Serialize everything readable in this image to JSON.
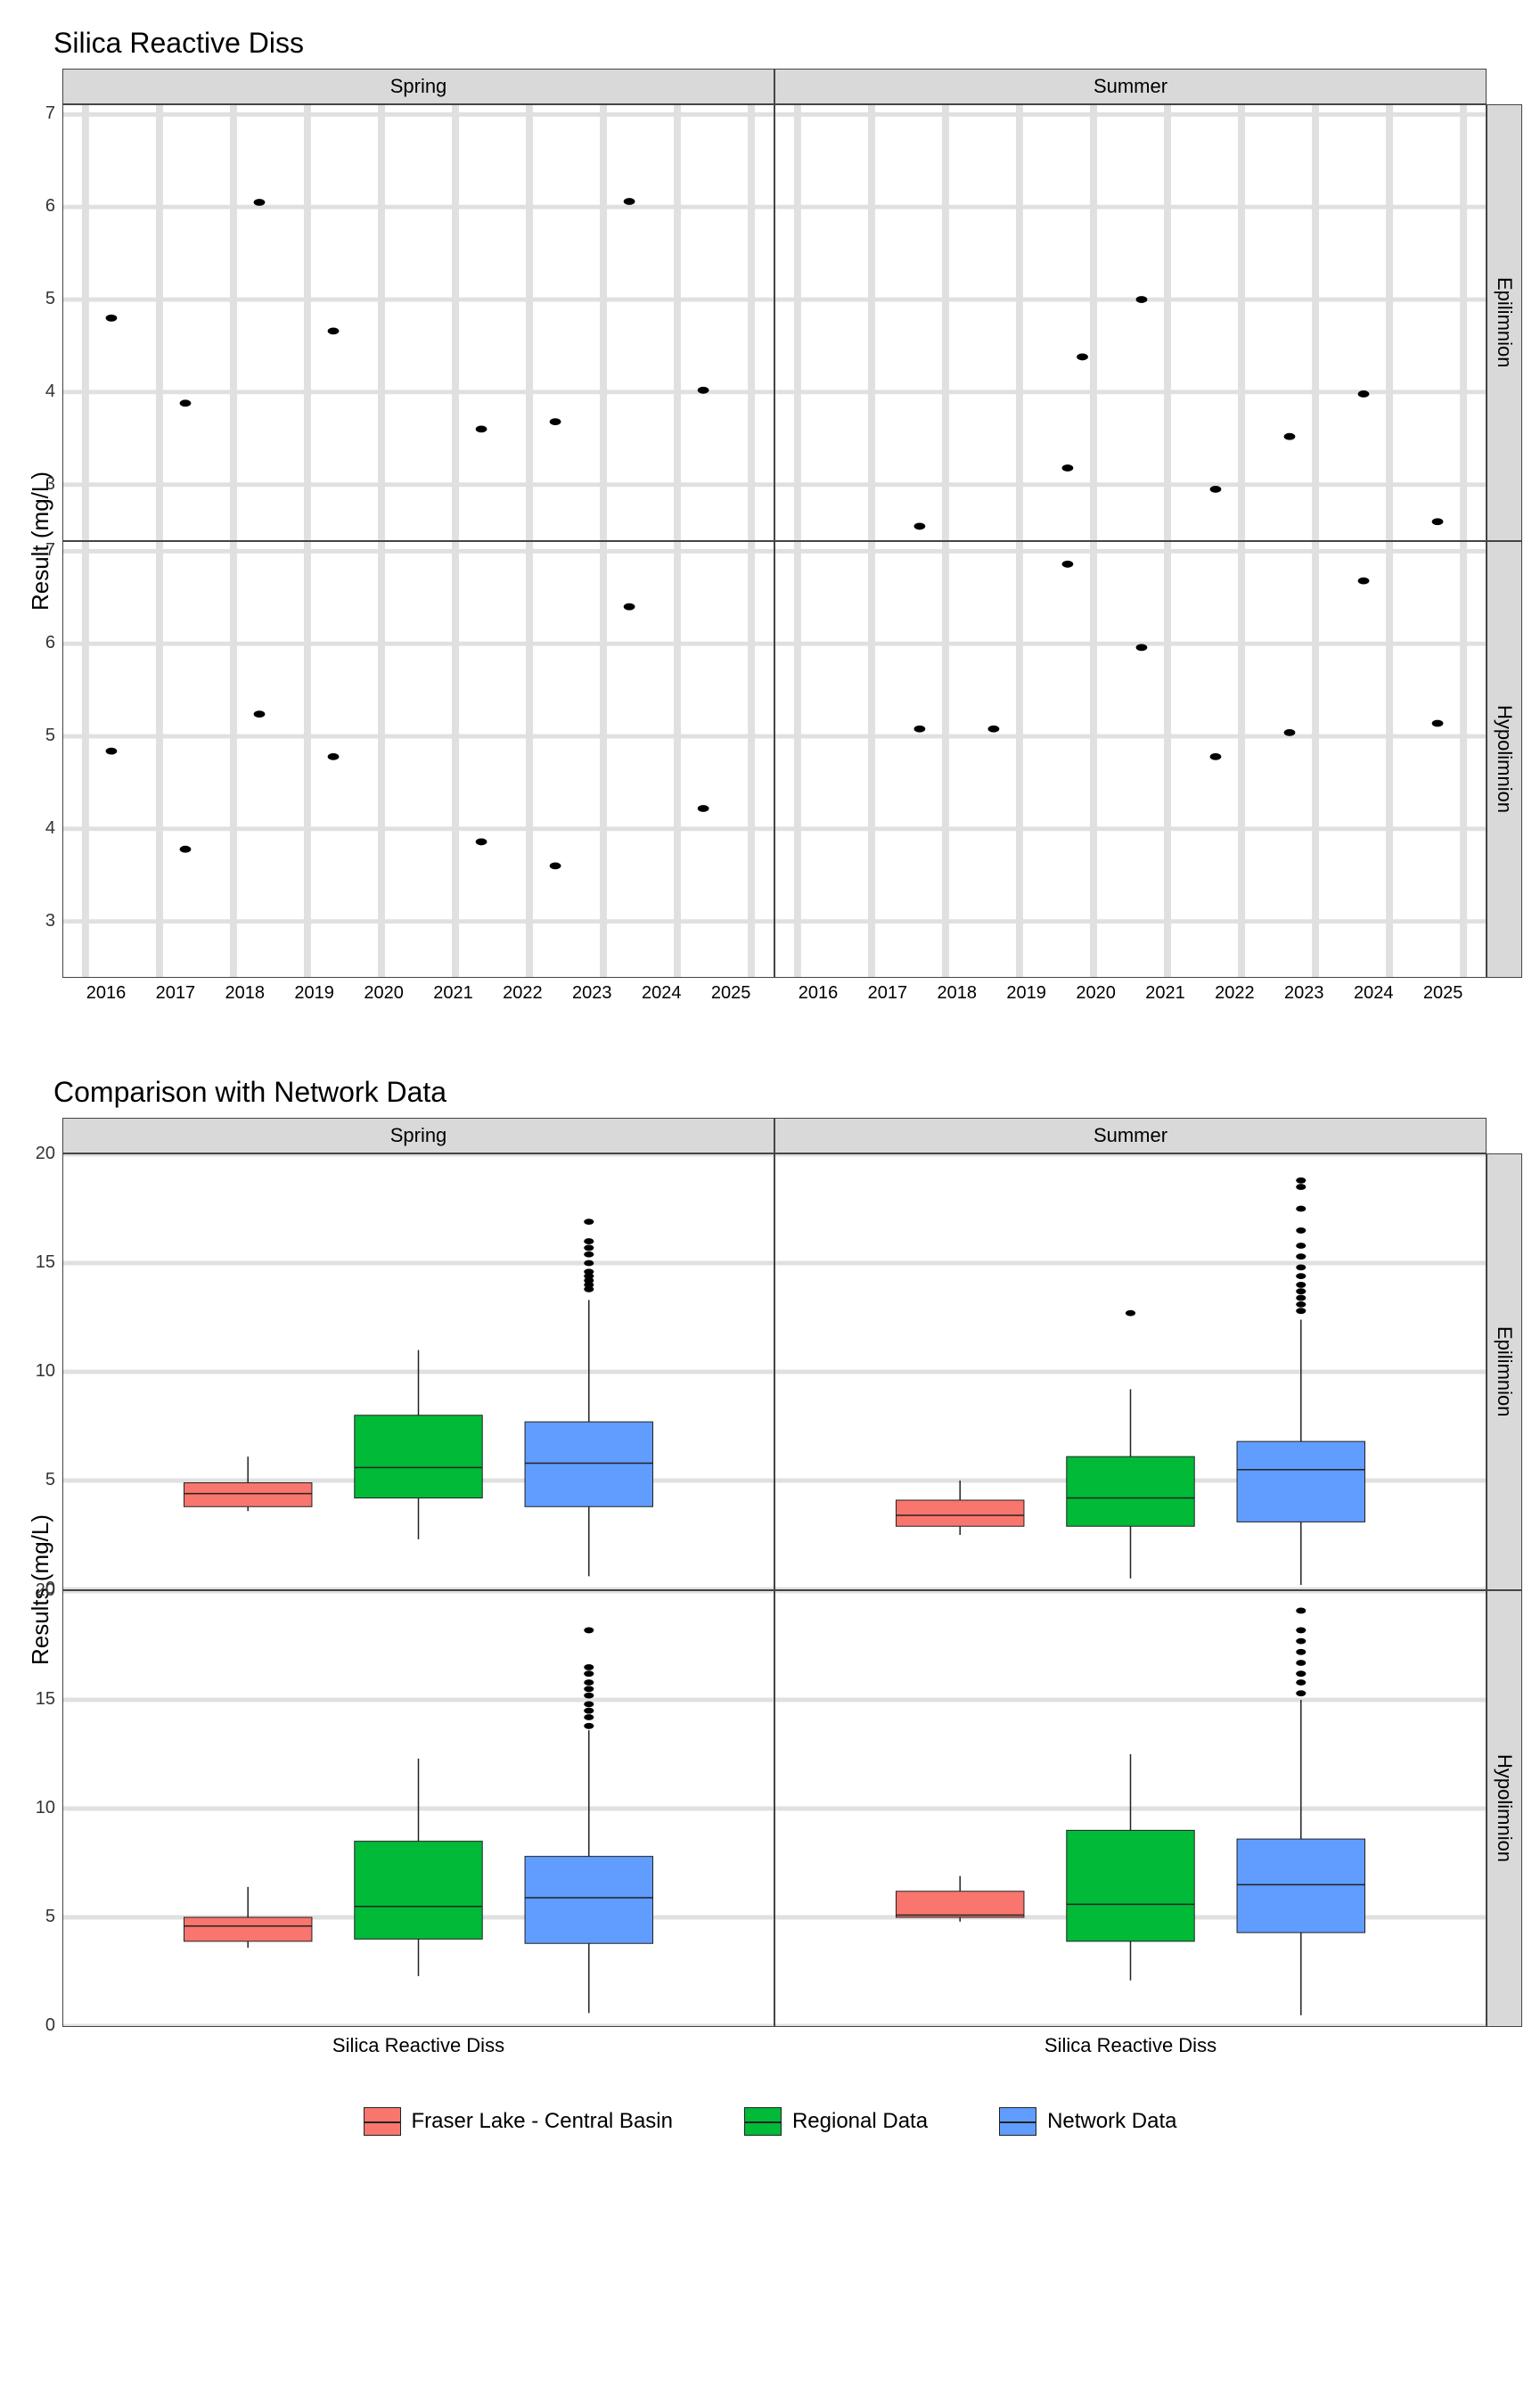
{
  "top": {
    "title": "Silica Reactive Diss",
    "ylabel": "Result (mg/L)",
    "col_strips": [
      "Spring",
      "Summer"
    ],
    "row_strips": [
      "Epilimnion",
      "Hypolimnion"
    ],
    "x_ticks": [
      2016,
      2017,
      2018,
      2019,
      2020,
      2021,
      2022,
      2023,
      2024,
      2025
    ],
    "y_ticks": [
      3,
      4,
      5,
      6,
      7
    ]
  },
  "bottom": {
    "title": "Comparison with Network Data",
    "ylabel": "Results (mg/L)",
    "col_strips": [
      "Spring",
      "Summer"
    ],
    "row_strips": [
      "Epilimnion",
      "Hypolimnion"
    ],
    "x_category": "Silica Reactive Diss",
    "y_ticks": [
      0,
      5,
      10,
      15,
      20
    ]
  },
  "legend": {
    "items": [
      {
        "label": "Fraser Lake - Central Basin",
        "color": "#f8766d"
      },
      {
        "label": "Regional Data",
        "color": "#00ba38"
      },
      {
        "label": "Network Data",
        "color": "#619cff"
      }
    ]
  },
  "chart_data": [
    {
      "id": "top",
      "type": "scatter",
      "xlabel": "",
      "ylabel": "Result (mg/L)",
      "xlim": [
        2015.7,
        2025.3
      ],
      "ylim": [
        2.4,
        7.1
      ],
      "facets": {
        "cols": [
          "Spring",
          "Summer"
        ],
        "rows": [
          "Epilimnion",
          "Hypolimnion"
        ]
      },
      "panels": {
        "Spring|Epilimnion": [
          {
            "x": 2016.35,
            "y": 4.8
          },
          {
            "x": 2017.35,
            "y": 3.88
          },
          {
            "x": 2018.35,
            "y": 6.05
          },
          {
            "x": 2019.35,
            "y": 4.66
          },
          {
            "x": 2021.35,
            "y": 3.6
          },
          {
            "x": 2022.35,
            "y": 3.68
          },
          {
            "x": 2023.35,
            "y": 6.06
          },
          {
            "x": 2024.35,
            "y": 4.02
          }
        ],
        "Summer|Epilimnion": [
          {
            "x": 2017.65,
            "y": 2.55
          },
          {
            "x": 2019.65,
            "y": 3.18
          },
          {
            "x": 2019.85,
            "y": 4.38
          },
          {
            "x": 2020.65,
            "y": 5.0
          },
          {
            "x": 2021.65,
            "y": 2.95
          },
          {
            "x": 2022.65,
            "y": 3.52
          },
          {
            "x": 2023.65,
            "y": 3.98
          },
          {
            "x": 2024.65,
            "y": 2.6
          }
        ],
        "Spring|Hypolimnion": [
          {
            "x": 2016.35,
            "y": 4.84
          },
          {
            "x": 2017.35,
            "y": 3.78
          },
          {
            "x": 2018.35,
            "y": 5.24
          },
          {
            "x": 2019.35,
            "y": 4.78
          },
          {
            "x": 2021.35,
            "y": 3.86
          },
          {
            "x": 2022.35,
            "y": 3.6
          },
          {
            "x": 2023.35,
            "y": 6.4
          },
          {
            "x": 2024.35,
            "y": 4.22
          }
        ],
        "Summer|Hypolimnion": [
          {
            "x": 2017.65,
            "y": 5.08
          },
          {
            "x": 2018.65,
            "y": 5.08
          },
          {
            "x": 2019.65,
            "y": 6.86
          },
          {
            "x": 2020.65,
            "y": 5.96
          },
          {
            "x": 2021.65,
            "y": 4.78
          },
          {
            "x": 2022.65,
            "y": 5.04
          },
          {
            "x": 2023.65,
            "y": 6.68
          },
          {
            "x": 2024.65,
            "y": 5.14
          }
        ]
      }
    },
    {
      "id": "bottom",
      "type": "boxplot",
      "xlabel": "Silica Reactive Diss",
      "ylabel": "Results (mg/L)",
      "ylim": [
        0,
        20
      ],
      "facets": {
        "cols": [
          "Spring",
          "Summer"
        ],
        "rows": [
          "Epilimnion",
          "Hypolimnion"
        ]
      },
      "series_colors": {
        "Fraser Lake - Central Basin": "#f8766d",
        "Regional Data": "#00ba38",
        "Network Data": "#619cff"
      },
      "panels": {
        "Spring|Epilimnion": [
          {
            "series": "Fraser Lake - Central Basin",
            "min": 3.6,
            "q1": 3.8,
            "median": 4.4,
            "q3": 4.9,
            "max": 6.1,
            "outliers": []
          },
          {
            "series": "Regional Data",
            "min": 2.3,
            "q1": 4.2,
            "median": 5.6,
            "q3": 8.0,
            "max": 11.0,
            "outliers": []
          },
          {
            "series": "Network Data",
            "min": 0.6,
            "q1": 3.8,
            "median": 5.8,
            "q3": 7.7,
            "max": 13.3,
            "outliers": [
              13.8,
              14.0,
              14.2,
              14.4,
              14.6,
              15.0,
              15.4,
              15.7,
              16.0,
              16.9
            ]
          }
        ],
        "Summer|Epilimnion": [
          {
            "series": "Fraser Lake - Central Basin",
            "min": 2.5,
            "q1": 2.9,
            "median": 3.4,
            "q3": 4.1,
            "max": 5.0,
            "outliers": []
          },
          {
            "series": "Regional Data",
            "min": 0.5,
            "q1": 2.9,
            "median": 4.2,
            "q3": 6.1,
            "max": 9.2,
            "outliers": [
              12.7
            ]
          },
          {
            "series": "Network Data",
            "min": 0.2,
            "q1": 3.1,
            "median": 5.5,
            "q3": 6.8,
            "max": 12.4,
            "outliers": [
              12.8,
              13.1,
              13.4,
              13.7,
              14.0,
              14.4,
              14.8,
              15.3,
              15.8,
              16.5,
              17.5,
              18.5,
              18.8
            ]
          }
        ],
        "Spring|Hypolimnion": [
          {
            "series": "Fraser Lake - Central Basin",
            "min": 3.6,
            "q1": 3.9,
            "median": 4.6,
            "q3": 5.0,
            "max": 6.4,
            "outliers": []
          },
          {
            "series": "Regional Data",
            "min": 2.3,
            "q1": 4.0,
            "median": 5.5,
            "q3": 8.5,
            "max": 12.3,
            "outliers": []
          },
          {
            "series": "Network Data",
            "min": 0.6,
            "q1": 3.8,
            "median": 5.9,
            "q3": 7.8,
            "max": 13.6,
            "outliers": [
              13.8,
              14.2,
              14.5,
              14.8,
              15.2,
              15.5,
              15.8,
              16.2,
              16.5,
              18.2
            ]
          }
        ],
        "Summer|Hypolimnion": [
          {
            "series": "Fraser Lake - Central Basin",
            "min": 4.8,
            "q1": 5.0,
            "median": 5.1,
            "q3": 6.2,
            "max": 6.9,
            "outliers": []
          },
          {
            "series": "Regional Data",
            "min": 2.1,
            "q1": 3.9,
            "median": 5.6,
            "q3": 9.0,
            "max": 12.5,
            "outliers": []
          },
          {
            "series": "Network Data",
            "min": 0.5,
            "q1": 4.3,
            "median": 6.5,
            "q3": 8.6,
            "max": 15.0,
            "outliers": [
              15.3,
              15.8,
              16.2,
              16.7,
              17.2,
              17.7,
              18.2,
              19.1
            ]
          }
        ]
      }
    }
  ]
}
